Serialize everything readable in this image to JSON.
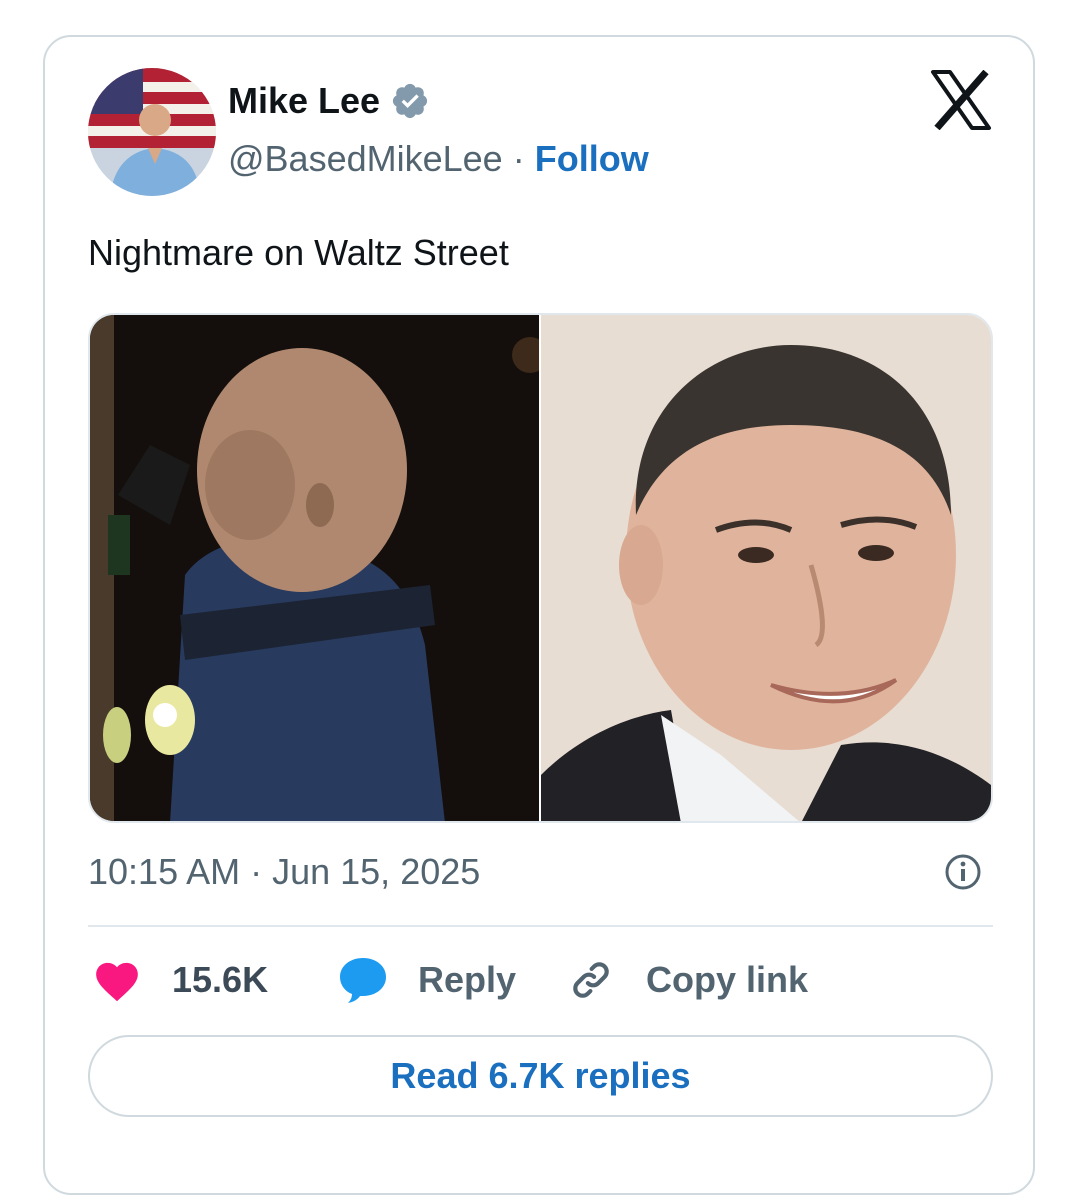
{
  "author": {
    "display_name": "Mike Lee",
    "handle": "@BasedMikeLee",
    "separator": "·",
    "follow_label": "Follow",
    "verified_icon": "verified-badge-icon",
    "avatar_icon": "profile-avatar"
  },
  "platform_logo": "x-logo-icon",
  "tweet": {
    "text": "Nightmare on Waltz Street",
    "media": [
      "masked-officer-photo",
      "smiling-man-in-suit-photo"
    ],
    "timestamp": "10:15 AM · Jun 15, 2025"
  },
  "actions": {
    "likes_count": "15.6K",
    "reply_label": "Reply",
    "copy_link_label": "Copy link"
  },
  "read_replies_label": "Read 6.7K replies",
  "colors": {
    "link_blue": "#1a6fbf",
    "like_pink": "#f91880",
    "reply_blue": "#1d9bf0",
    "verified_gray": "#829aab",
    "text_dark": "#0f1419",
    "text_gray": "#536471",
    "border": "#cfd9de"
  }
}
